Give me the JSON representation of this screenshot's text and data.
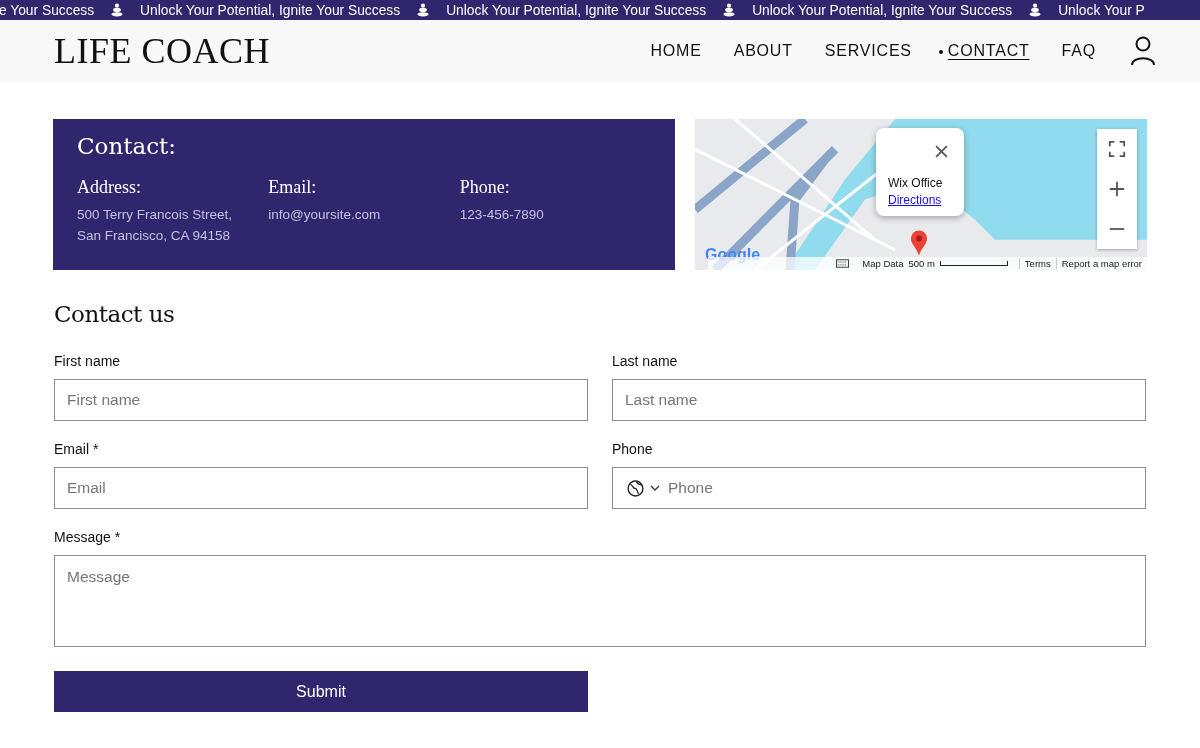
{
  "banner": {
    "items": [
      "e Your Success",
      "Unlock Your Potential, Ignite Your Success",
      "Unlock Your Potential, Ignite Your Success",
      "Unlock Your Potential, Ignite Your Success",
      "Unlock Your P"
    ]
  },
  "header": {
    "logo": "LIFE COACH",
    "nav": [
      {
        "label": "HOME",
        "selected": false
      },
      {
        "label": "ABOUT",
        "selected": false
      },
      {
        "label": "SERVICES",
        "selected": false
      },
      {
        "label": "CONTACT",
        "selected": true
      },
      {
        "label": "FAQ",
        "selected": false
      }
    ]
  },
  "contact_card": {
    "title": "Contact:",
    "columns": [
      {
        "heading": "Address:",
        "lines": [
          "500 Terry Francois Street,",
          "San Francisco, CA 94158"
        ]
      },
      {
        "heading": "Email:",
        "lines": [
          "info@yoursite.com"
        ]
      },
      {
        "heading": "Phone:",
        "lines": [
          "123-456-7890"
        ]
      }
    ]
  },
  "map": {
    "popup_title": "Wix Office",
    "popup_link": "Directions",
    "logo": "Google",
    "footer": [
      "Map Data",
      "500 m",
      "Terms",
      "Report a map error"
    ]
  },
  "form": {
    "title": "Contact us",
    "fields": [
      {
        "kind": "text",
        "label": "First name",
        "placeholder": "First name"
      },
      {
        "kind": "text",
        "label": "Last name",
        "placeholder": "Last name"
      },
      {
        "kind": "text",
        "label": "Email *",
        "placeholder": "Email"
      },
      {
        "kind": "phone",
        "label": "Phone",
        "placeholder": "Phone"
      },
      {
        "kind": "textarea",
        "label": "Message *",
        "placeholder": "Message"
      }
    ],
    "submit": "Submit"
  }
}
